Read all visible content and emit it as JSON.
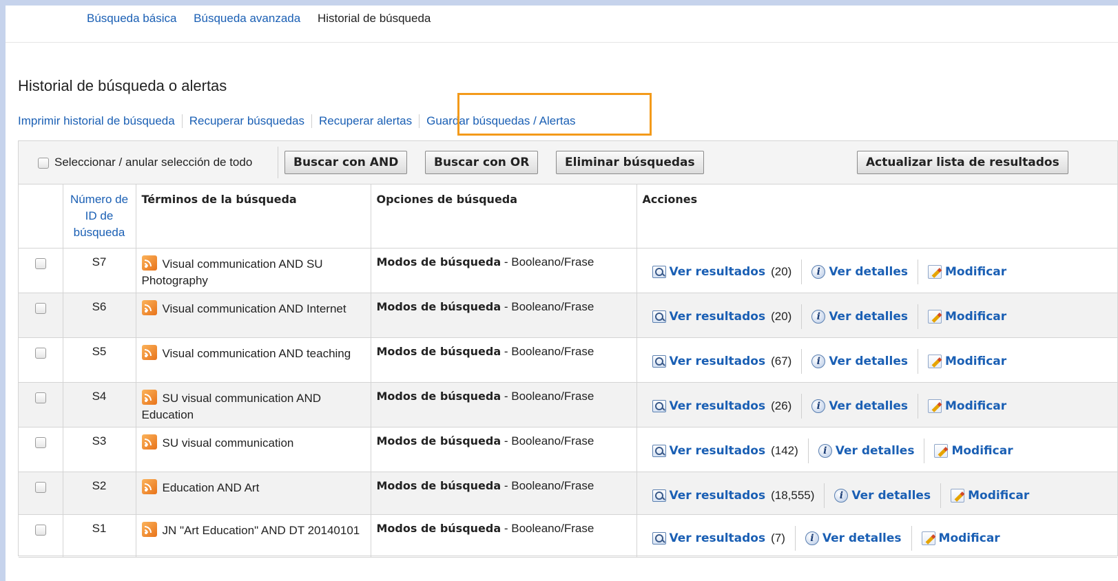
{
  "topnav": {
    "basic": "Búsqueda básica",
    "advanced": "Búsqueda avanzada",
    "history": "Historial de búsqueda"
  },
  "page_title": "Historial de búsqueda o alertas",
  "links": {
    "print": "Imprimir historial de búsqueda",
    "retrieve_searches": "Recuperar búsquedas",
    "retrieve_alerts": "Recuperar alertas",
    "save": "Guardar búsquedas / Alertas"
  },
  "toolbar": {
    "select_all": "Seleccionar / anular selección de todo",
    "and": "Buscar con AND",
    "or": "Buscar con OR",
    "delete": "Eliminar búsquedas",
    "refresh": "Actualizar lista de resultados"
  },
  "headers": {
    "id": "Número de ID de búsqueda",
    "terms": "Términos de la búsqueda",
    "options": "Opciones de búsqueda",
    "actions": "Acciones"
  },
  "options_label": "Modos de búsqueda",
  "options_value": " - Booleano/Frase",
  "action_labels": {
    "results": "Ver resultados",
    "details": "Ver detalles",
    "modify": "Modificar"
  },
  "rows": [
    {
      "id": "S7",
      "terms": "Visual communication AND SU Photography",
      "count": "(20)"
    },
    {
      "id": "S6",
      "terms": "Visual communication AND Internet",
      "count": "(20)"
    },
    {
      "id": "S5",
      "terms": "Visual communication AND teaching",
      "count": "(67)"
    },
    {
      "id": "S4",
      "terms": "SU visual communication AND Education",
      "count": "(26)"
    },
    {
      "id": "S3",
      "terms": "SU visual communication",
      "count": "(142)"
    },
    {
      "id": "S2",
      "terms": "Education AND Art",
      "count": "(18,555)"
    },
    {
      "id": "S1",
      "terms": "JN \"Art Education\" AND DT 20140101",
      "count": "(7)"
    }
  ],
  "colors": {
    "link": "#1a5fb4",
    "highlight": "#f39a1a",
    "frame": "#c6d3ec"
  }
}
